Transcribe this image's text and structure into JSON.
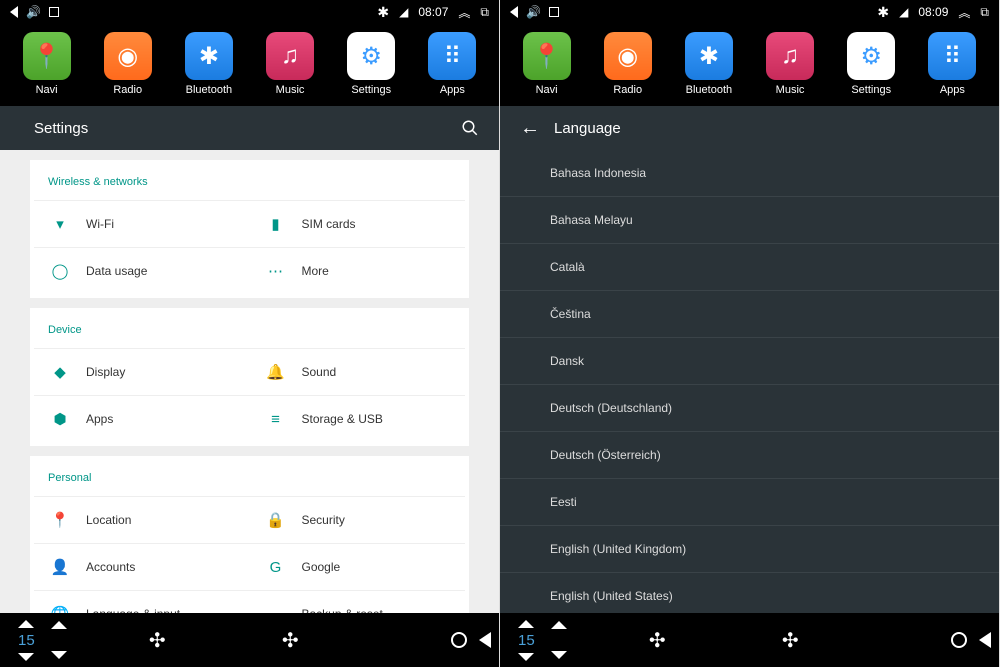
{
  "status": {
    "time_left": "08:07",
    "time_right": "08:09"
  },
  "apps": [
    {
      "label": "Navi",
      "color": "ico-green",
      "glyph": "📍"
    },
    {
      "label": "Radio",
      "color": "ico-orange",
      "glyph": "◉"
    },
    {
      "label": "Bluetooth",
      "color": "ico-blue",
      "glyph": "✱"
    },
    {
      "label": "Music",
      "color": "ico-pink",
      "glyph": "♫"
    },
    {
      "label": "Settings",
      "color": "ico-white",
      "glyph": "⚙"
    },
    {
      "label": "Apps",
      "color": "ico-blue",
      "glyph": "⠿"
    }
  ],
  "left_header": "Settings",
  "right_header": "Language",
  "sections": [
    {
      "title": "Wireless & networks",
      "items": [
        {
          "icon": "▾",
          "label": "Wi-Fi"
        },
        {
          "icon": "▮",
          "label": "SIM cards"
        },
        {
          "icon": "◯",
          "label": "Data usage"
        },
        {
          "icon": "⋯",
          "label": "More"
        }
      ]
    },
    {
      "title": "Device",
      "items": [
        {
          "icon": "◆",
          "label": "Display"
        },
        {
          "icon": "🔔",
          "label": "Sound"
        },
        {
          "icon": "⬢",
          "label": "Apps"
        },
        {
          "icon": "≡",
          "label": "Storage & USB"
        }
      ]
    },
    {
      "title": "Personal",
      "items": [
        {
          "icon": "📍",
          "label": "Location"
        },
        {
          "icon": "🔒",
          "label": "Security"
        },
        {
          "icon": "👤",
          "label": "Accounts"
        },
        {
          "icon": "G",
          "label": "Google"
        },
        {
          "icon": "🌐",
          "label": "Language & input"
        },
        {
          "icon": "☁",
          "label": "Backup & reset"
        }
      ]
    }
  ],
  "languages": [
    "Bahasa Indonesia",
    "Bahasa Melayu",
    "Català",
    "Čeština",
    "Dansk",
    "Deutsch (Deutschland)",
    "Deutsch (Österreich)",
    "Eesti",
    "English (United Kingdom)",
    "English (United States)"
  ],
  "temp": "15"
}
